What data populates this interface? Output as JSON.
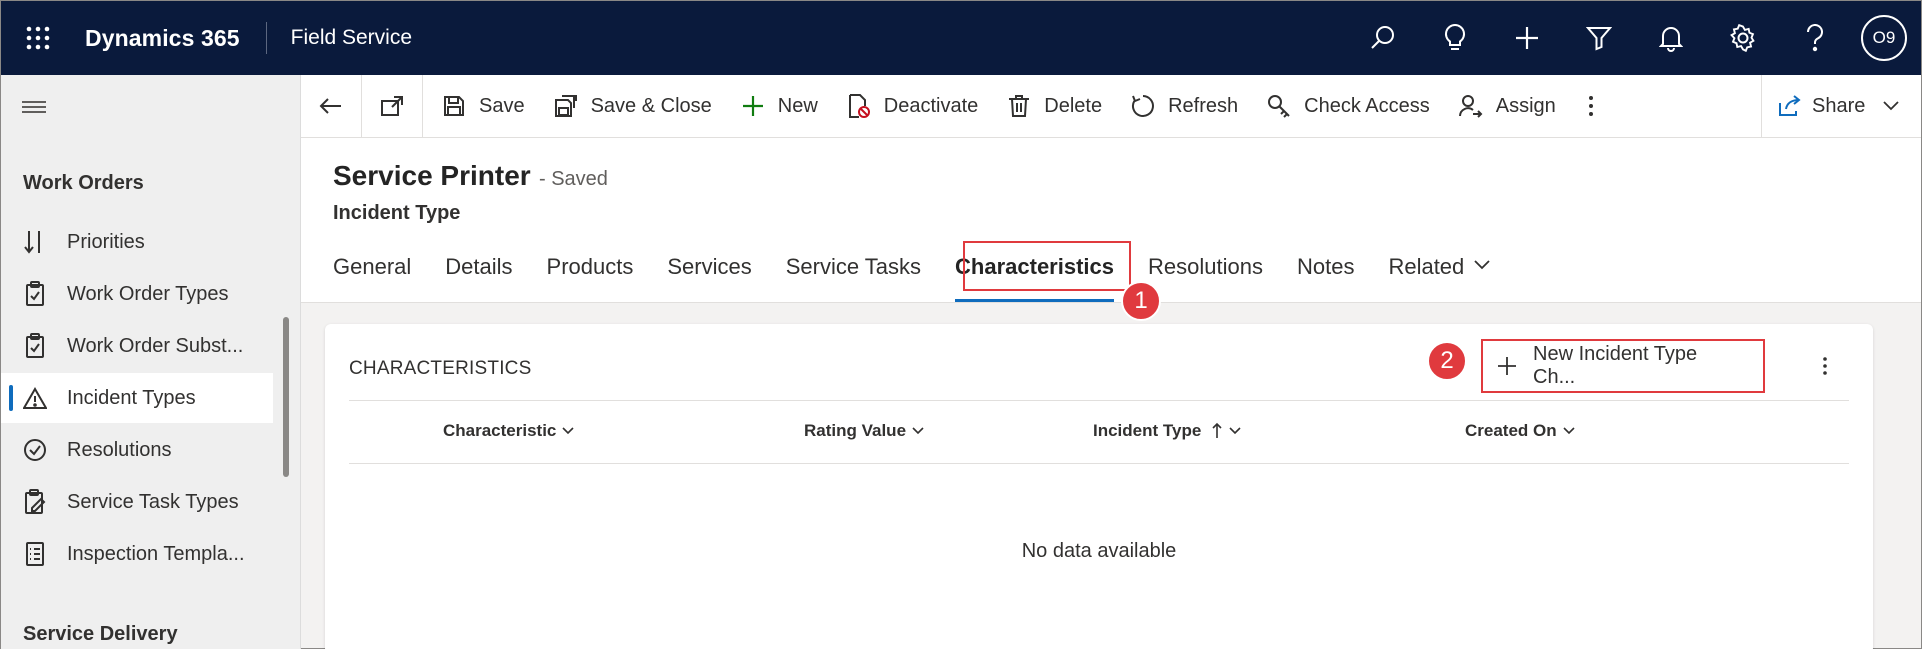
{
  "topbar": {
    "brand": "Dynamics 365",
    "app": "Field Service",
    "avatar_initials": "O9",
    "icons": [
      "search-icon",
      "lightbulb-icon",
      "plus-icon",
      "filter-icon",
      "bell-icon",
      "gear-icon",
      "help-icon"
    ]
  },
  "sidebar": {
    "group1_title": "Work Orders",
    "group2_title": "Service Delivery",
    "items": [
      {
        "label": "Priorities",
        "icon": "priorities-icon"
      },
      {
        "label": "Work Order Types",
        "icon": "clipboard-icon"
      },
      {
        "label": "Work Order Subst...",
        "icon": "clipboard-icon"
      },
      {
        "label": "Incident Types",
        "icon": "warning-icon",
        "active": true
      },
      {
        "label": "Resolutions",
        "icon": "check-circle-icon"
      },
      {
        "label": "Service Task Types",
        "icon": "clipboard-edit-icon"
      },
      {
        "label": "Inspection Templa...",
        "icon": "checklist-icon"
      }
    ]
  },
  "commandbar": {
    "save": "Save",
    "save_close": "Save & Close",
    "new": "New",
    "deactivate": "Deactivate",
    "delete": "Delete",
    "refresh": "Refresh",
    "check_access": "Check Access",
    "assign": "Assign",
    "share": "Share"
  },
  "record": {
    "title": "Service Printer",
    "status": "- Saved",
    "entity": "Incident Type"
  },
  "tabs": [
    "General",
    "Details",
    "Products",
    "Services",
    "Service Tasks",
    "Characteristics",
    "Resolutions",
    "Notes",
    "Related"
  ],
  "selected_tab": "Characteristics",
  "callouts": {
    "one": "1",
    "two": "2"
  },
  "section": {
    "title": "CHARACTERISTICS",
    "new_button": "New Incident Type Ch...",
    "columns": [
      "Characteristic",
      "Rating Value",
      "Incident Type",
      "Created On"
    ],
    "sorted_column": "Incident Type",
    "empty_message": "No data available"
  },
  "colors": {
    "topbar": "#0a1a3c",
    "accent": "#0f6cbd",
    "callout": "#e03a3e"
  }
}
